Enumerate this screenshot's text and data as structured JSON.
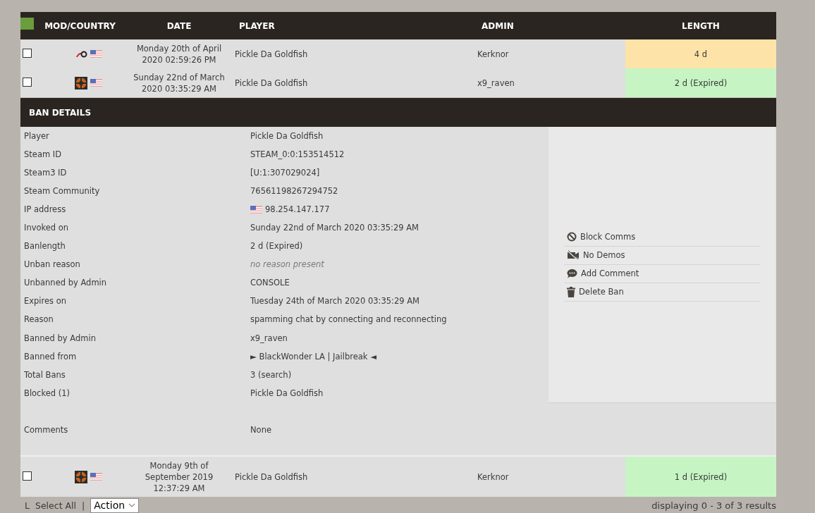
{
  "table": {
    "columns": [
      "MOD/COUNTRY",
      "DATE",
      "PLAYER",
      "ADMIN",
      "LENGTH"
    ],
    "rows": [
      {
        "checked": false,
        "mod": {
          "kind": "swirl"
        },
        "date": "Monday 20th of April 2020 02:59:26 PM",
        "player": "Pickle Da Goldfish",
        "admin": "Kerknor",
        "length": "4 d",
        "color": "#fde3a7"
      },
      {
        "checked": false,
        "mod": {
          "kind": "circle"
        },
        "date": "Sunday 22nd of March 2020 03:35:29 AM",
        "player": "Pickle Da Goldfish",
        "admin": "x9_raven",
        "length": "2 d (Expired)",
        "color": "#c6f5c3",
        "expanded": true
      }
    ],
    "details": {
      "title": "BAN DETAILS",
      "fields": [
        {
          "label": "Player",
          "value": "Pickle Da Goldfish",
          "kind": "text"
        },
        {
          "label": "Steam ID",
          "value": "STEAM_0:0:153514512",
          "kind": "text"
        },
        {
          "label": "Steam3 ID",
          "value": "[U:1:307029024]",
          "kind": "text"
        },
        {
          "label": "Steam Community",
          "value": "76561198267294752",
          "kind": "text"
        },
        {
          "label": "IP address",
          "value": "98.254.147.177",
          "kind": "flag"
        },
        {
          "label": "Invoked on",
          "value": "Sunday 22nd of March 2020 03:35:29 AM",
          "kind": "text"
        },
        {
          "label": "Banlength",
          "value": "2 d (Expired)",
          "kind": "text"
        },
        {
          "label": "Unban reason",
          "value": "no reason present",
          "kind": "muted"
        },
        {
          "label": "Unbanned by Admin",
          "value": "CONSOLE",
          "kind": "text"
        },
        {
          "label": "Expires on",
          "value": "Tuesday 24th of March 2020 03:35:29 AM",
          "kind": "text"
        },
        {
          "label": "Reason",
          "value": "spamming chat by connecting and reconnecting",
          "kind": "text"
        },
        {
          "label": "Banned by Admin",
          "value": "x9_raven",
          "kind": "text"
        },
        {
          "label": "Banned from",
          "value": "► BlackWonder LA | Jailbreak ◄",
          "kind": "text"
        },
        {
          "label": "Total Bans",
          "value": "3 (search)",
          "kind": "text"
        },
        {
          "label": "Blocked (1)",
          "value": "Pickle Da Goldfish",
          "kind": "text"
        }
      ],
      "comments": {
        "label": "Comments",
        "value": "None"
      },
      "actions": [
        {
          "label": "Block Comms",
          "kind": "block"
        },
        {
          "label": "No Demos",
          "kind": "nodemo"
        },
        {
          "label": "Add Comment",
          "kind": "comment"
        },
        {
          "label": "Delete Ban",
          "kind": "trash"
        }
      ]
    },
    "rows_after": [
      {
        "checked": false,
        "mod": {
          "kind": "circle"
        },
        "date": "Monday 9th of September 2019 12:37:29 AM",
        "player": "Pickle Da Goldfish",
        "admin": "Kerknor",
        "length": "1 d (Expired)",
        "color": "#c6f5c3"
      }
    ]
  },
  "footer": {
    "mark": "L",
    "select_all": "Select All",
    "separator": "|",
    "action": {
      "value": "Action"
    },
    "summary": "displaying 0 - 3 of 3 results"
  }
}
